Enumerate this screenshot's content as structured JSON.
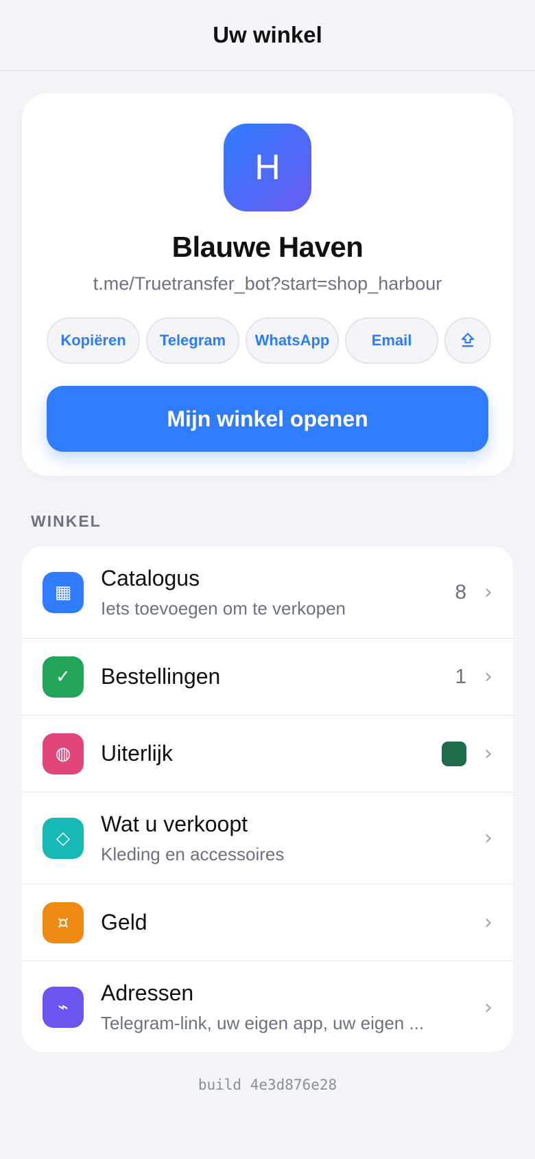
{
  "header": {
    "title": "Uw winkel"
  },
  "shop": {
    "logo_letter": "H",
    "name": "Blauwe Haven",
    "link": "t.me/Truetransfer_bot?start=shop_harbour",
    "share_buttons": [
      "Kopiëren",
      "Telegram",
      "WhatsApp",
      "Email"
    ],
    "share_more_icon": "share-icon",
    "open_button": "Mijn winkel openen"
  },
  "section": {
    "label": "WINKEL"
  },
  "items": [
    {
      "title": "Catalogus",
      "subtitle": "Iets toevoegen om te verkopen",
      "count": "8",
      "icon": "grid-icon",
      "icon_glyph": "▦",
      "color": "#2f7cff"
    },
    {
      "title": "Bestellingen",
      "count": "1",
      "icon": "check-icon",
      "icon_glyph": "✓",
      "color": "#22a559"
    },
    {
      "title": "Uiterlijk",
      "swatch": "#1e6b49",
      "icon": "palette-icon",
      "icon_glyph": "◍",
      "color": "#e2457c"
    },
    {
      "title": "Wat u verkoopt",
      "subtitle": "Kleding en accessoires",
      "icon": "diamond-icon",
      "icon_glyph": "◇",
      "color": "#16b9b6"
    },
    {
      "title": "Geld",
      "icon": "currency-icon",
      "icon_glyph": "¤",
      "color": "#ee8a12"
    },
    {
      "title": "Adressen",
      "subtitle": "Telegram-link, uw eigen app, uw eigen ...",
      "icon": "link-icon",
      "icon_glyph": "⌁",
      "color": "#6a55ee"
    }
  ],
  "footer": {
    "build": "build 4e3d876e28"
  }
}
